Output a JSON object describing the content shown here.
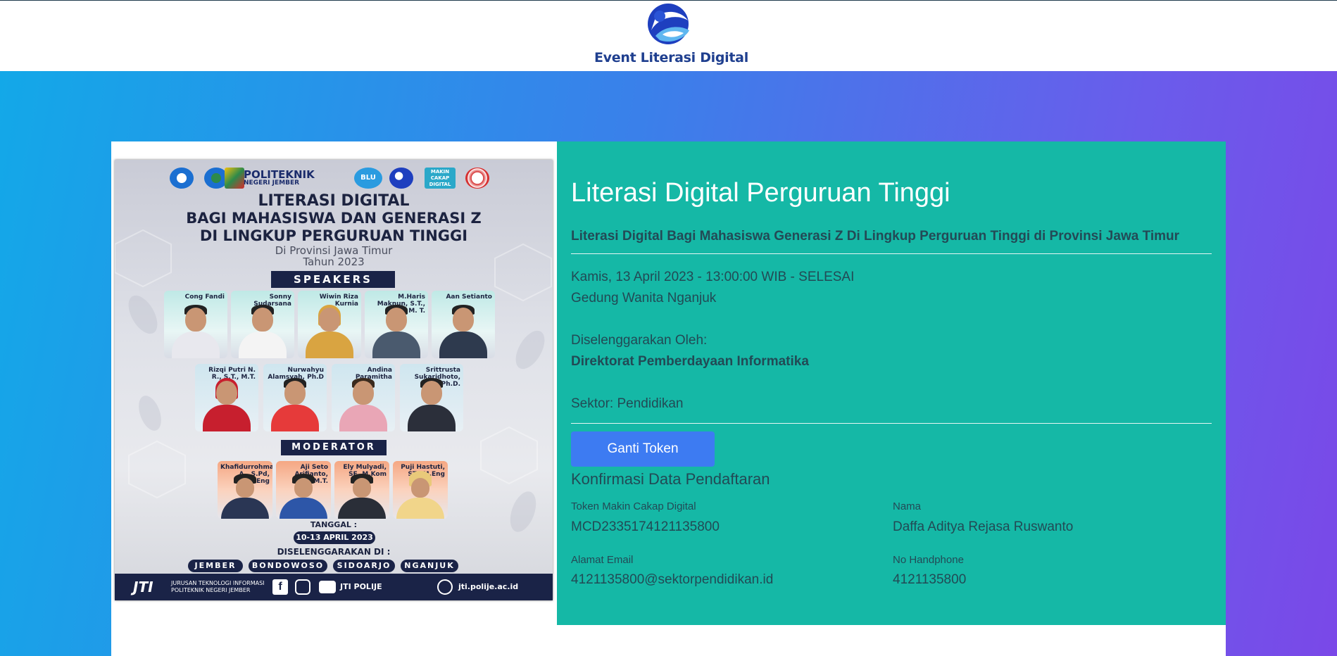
{
  "header": {
    "brand": "Event Literasi Digital",
    "logo_icon": "kominfo-swirl-logo-icon"
  },
  "colors": {
    "accent_teal": "#15b8a6",
    "button_blue": "#3d7bf2",
    "gradient_start": "#13a8e8",
    "gradient_end": "#7a48e8"
  },
  "poster": {
    "org_name": "POLITEKNIK",
    "org_sub": "NEGERI JEMBER",
    "blu": "BLU",
    "makin_cakap": "MAKIN CAKAP DIGITAL",
    "title_line1": "LITERASI DIGITAL",
    "title_line2": "BAGI MAHASISWA DAN GENERASI Z",
    "title_line3": "DI LINGKUP PERGURUAN TINGGI",
    "sub_line1": "Di Provinsi Jawa Timur",
    "sub_line2": "Tahun 2023",
    "speakers_label": "SPEAKERS",
    "speakers_row1": [
      "Cong Fandi",
      "Sonny Sudarsana",
      "Wiwin Riza Kurnia",
      "M.Haris Maknun, S.T., M. T.",
      "Aan Setianto"
    ],
    "speakers_row2": [
      "Rizqi Putri N. R., S.T., M.T.",
      "Nurwahyu Alamsyah, Ph.D",
      "Andina Paramitha",
      "Srittrusta Sukaridhoto, ST., Ph.D."
    ],
    "moderator_label": "MODERATOR",
    "moderators": [
      "Khafidurrohman A., S.Pd, M.Eng",
      "Aji Seto Arifianto, S.ST., M.T.",
      "Ely Mulyadi, SE, M.Kom",
      "Puji Hastuti, ST., M.Eng"
    ],
    "date_label": "TANGGAL :",
    "date_value": "10-13 APRIL 2023",
    "venue_label": "DISELENGGARAKAN DI :",
    "venues": [
      "JEMBER",
      "BONDOWOSO",
      "SIDOARJO",
      "NGANJUK"
    ],
    "footer_org": "JTI",
    "footer_org_sub1": "JURUSAN TEKNOLOGI INFORMASI",
    "footer_org_sub2": "POLITEKNIK NEGERI JEMBER",
    "footer_social": "JTI POLIJE",
    "footer_web": "jti.polije.ac.id"
  },
  "event": {
    "title": "Literasi Digital Perguruan Tinggi",
    "subtitle": "Literasi Digital Bagi Mahasiswa Generasi Z Di Lingkup Perguruan Tinggi di Provinsi Jawa Timur",
    "datetime": "Kamis, 13 April 2023 - 13:00:00 WIB - SELESAI",
    "location": "Gedung Wanita Nganjuk",
    "organizer_label": "Diselenggarakan Oleh:",
    "organizer": "Direktorat Pemberdayaan Informatika",
    "sector": "Sektor: Pendidikan"
  },
  "actions": {
    "change_token": "Ganti Token"
  },
  "confirmation": {
    "title": "Konfirmasi Data Pendaftaran",
    "token_label": "Token Makin Cakap Digital",
    "token_value": "MCD2335174121135800",
    "name_label": "Nama",
    "name_value": "Daffa Aditya Rejasa Ruswanto",
    "email_label": "Alamat Email",
    "email_value": "4121135800@sektorpendidikan.id",
    "phone_label": "No Handphone",
    "phone_value": "4121135800"
  }
}
